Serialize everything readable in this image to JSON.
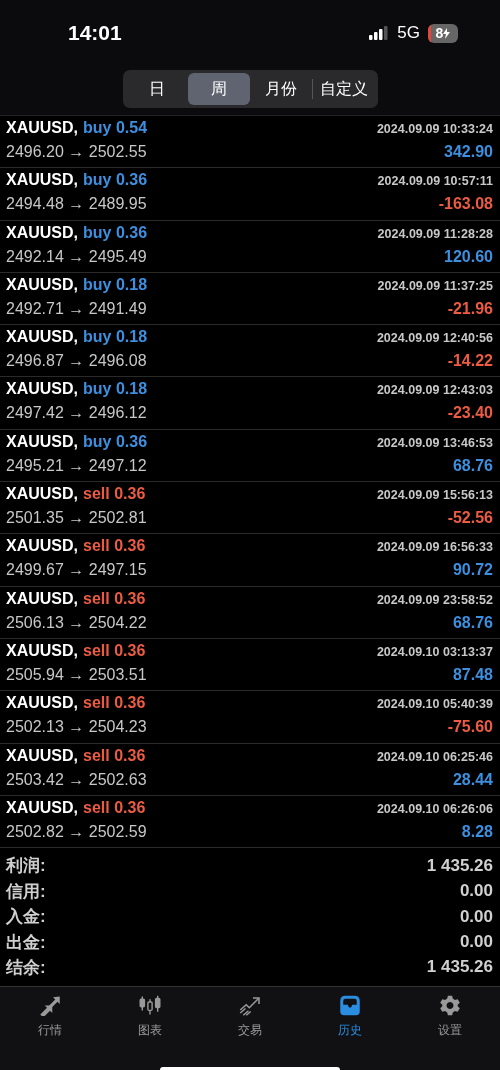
{
  "status_bar": {
    "time": "14:01",
    "network": "5G",
    "battery": "8"
  },
  "periods": [
    {
      "label": "日",
      "selected": false
    },
    {
      "label": "周",
      "selected": true
    },
    {
      "label": "月份",
      "selected": false
    },
    {
      "label": "自定义",
      "selected": false
    }
  ],
  "trades": [
    {
      "symbol": "XAUUSD,",
      "order": {
        "kind": "buy",
        "text": "buy 0.54"
      },
      "time": "2024.09.09 10:33:24",
      "prices": "2496.20 → 2502.55",
      "profit": {
        "kind": "gain",
        "text": "342.90"
      }
    },
    {
      "symbol": "XAUUSD,",
      "order": {
        "kind": "buy",
        "text": "buy 0.36"
      },
      "time": "2024.09.09 10:57:11",
      "prices": "2494.48 → 2489.95",
      "profit": {
        "kind": "loss",
        "text": "-163.08"
      }
    },
    {
      "symbol": "XAUUSD,",
      "order": {
        "kind": "buy",
        "text": "buy 0.36"
      },
      "time": "2024.09.09 11:28:28",
      "prices": "2492.14 → 2495.49",
      "profit": {
        "kind": "gain",
        "text": "120.60"
      }
    },
    {
      "symbol": "XAUUSD,",
      "order": {
        "kind": "buy",
        "text": "buy 0.18"
      },
      "time": "2024.09.09 11:37:25",
      "prices": "2492.71 → 2491.49",
      "profit": {
        "kind": "loss",
        "text": "-21.96"
      }
    },
    {
      "symbol": "XAUUSD,",
      "order": {
        "kind": "buy",
        "text": "buy 0.18"
      },
      "time": "2024.09.09 12:40:56",
      "prices": "2496.87 → 2496.08",
      "profit": {
        "kind": "loss",
        "text": "-14.22"
      }
    },
    {
      "symbol": "XAUUSD,",
      "order": {
        "kind": "buy",
        "text": "buy 0.18"
      },
      "time": "2024.09.09 12:43:03",
      "prices": "2497.42 → 2496.12",
      "profit": {
        "kind": "loss",
        "text": "-23.40"
      }
    },
    {
      "symbol": "XAUUSD,",
      "order": {
        "kind": "buy",
        "text": "buy 0.36"
      },
      "time": "2024.09.09 13:46:53",
      "prices": "2495.21 → 2497.12",
      "profit": {
        "kind": "gain",
        "text": "68.76"
      }
    },
    {
      "symbol": "XAUUSD,",
      "order": {
        "kind": "sell",
        "text": "sell 0.36"
      },
      "time": "2024.09.09 15:56:13",
      "prices": "2501.35 → 2502.81",
      "profit": {
        "kind": "loss",
        "text": "-52.56"
      }
    },
    {
      "symbol": "XAUUSD,",
      "order": {
        "kind": "sell",
        "text": "sell 0.36"
      },
      "time": "2024.09.09 16:56:33",
      "prices": "2499.67 → 2497.15",
      "profit": {
        "kind": "gain",
        "text": "90.72"
      }
    },
    {
      "symbol": "XAUUSD,",
      "order": {
        "kind": "sell",
        "text": "sell 0.36"
      },
      "time": "2024.09.09 23:58:52",
      "prices": "2506.13 → 2504.22",
      "profit": {
        "kind": "gain",
        "text": "68.76"
      }
    },
    {
      "symbol": "XAUUSD,",
      "order": {
        "kind": "sell",
        "text": "sell 0.36"
      },
      "time": "2024.09.10 03:13:37",
      "prices": "2505.94 → 2503.51",
      "profit": {
        "kind": "gain",
        "text": "87.48"
      }
    },
    {
      "symbol": "XAUUSD,",
      "order": {
        "kind": "sell",
        "text": "sell 0.36"
      },
      "time": "2024.09.10 05:40:39",
      "prices": "2502.13 → 2504.23",
      "profit": {
        "kind": "loss",
        "text": "-75.60"
      }
    },
    {
      "symbol": "XAUUSD,",
      "order": {
        "kind": "sell",
        "text": "sell 0.36"
      },
      "time": "2024.09.10 06:25:46",
      "prices": "2503.42 → 2502.63",
      "profit": {
        "kind": "gain",
        "text": "28.44"
      }
    },
    {
      "symbol": "XAUUSD,",
      "order": {
        "kind": "sell",
        "text": "sell 0.36"
      },
      "time": "2024.09.10 06:26:06",
      "prices": "2502.82 → 2502.59",
      "profit": {
        "kind": "gain",
        "text": "8.28"
      }
    }
  ],
  "summary": [
    {
      "label": "利润:",
      "value": "1 435.26"
    },
    {
      "label": "信用:",
      "value": "0.00"
    },
    {
      "label": "入金:",
      "value": "0.00"
    },
    {
      "label": "出金:",
      "value": "0.00"
    },
    {
      "label": "结余:",
      "value": "1 435.26"
    }
  ],
  "tab_bar": [
    {
      "kind": "quotes",
      "label": "行情",
      "selected": false
    },
    {
      "kind": "chart",
      "label": "图表",
      "selected": false
    },
    {
      "kind": "trade",
      "label": "交易",
      "selected": false
    },
    {
      "kind": "history",
      "label": "历史",
      "selected": true
    },
    {
      "kind": "settings",
      "label": "设置",
      "selected": false
    }
  ]
}
